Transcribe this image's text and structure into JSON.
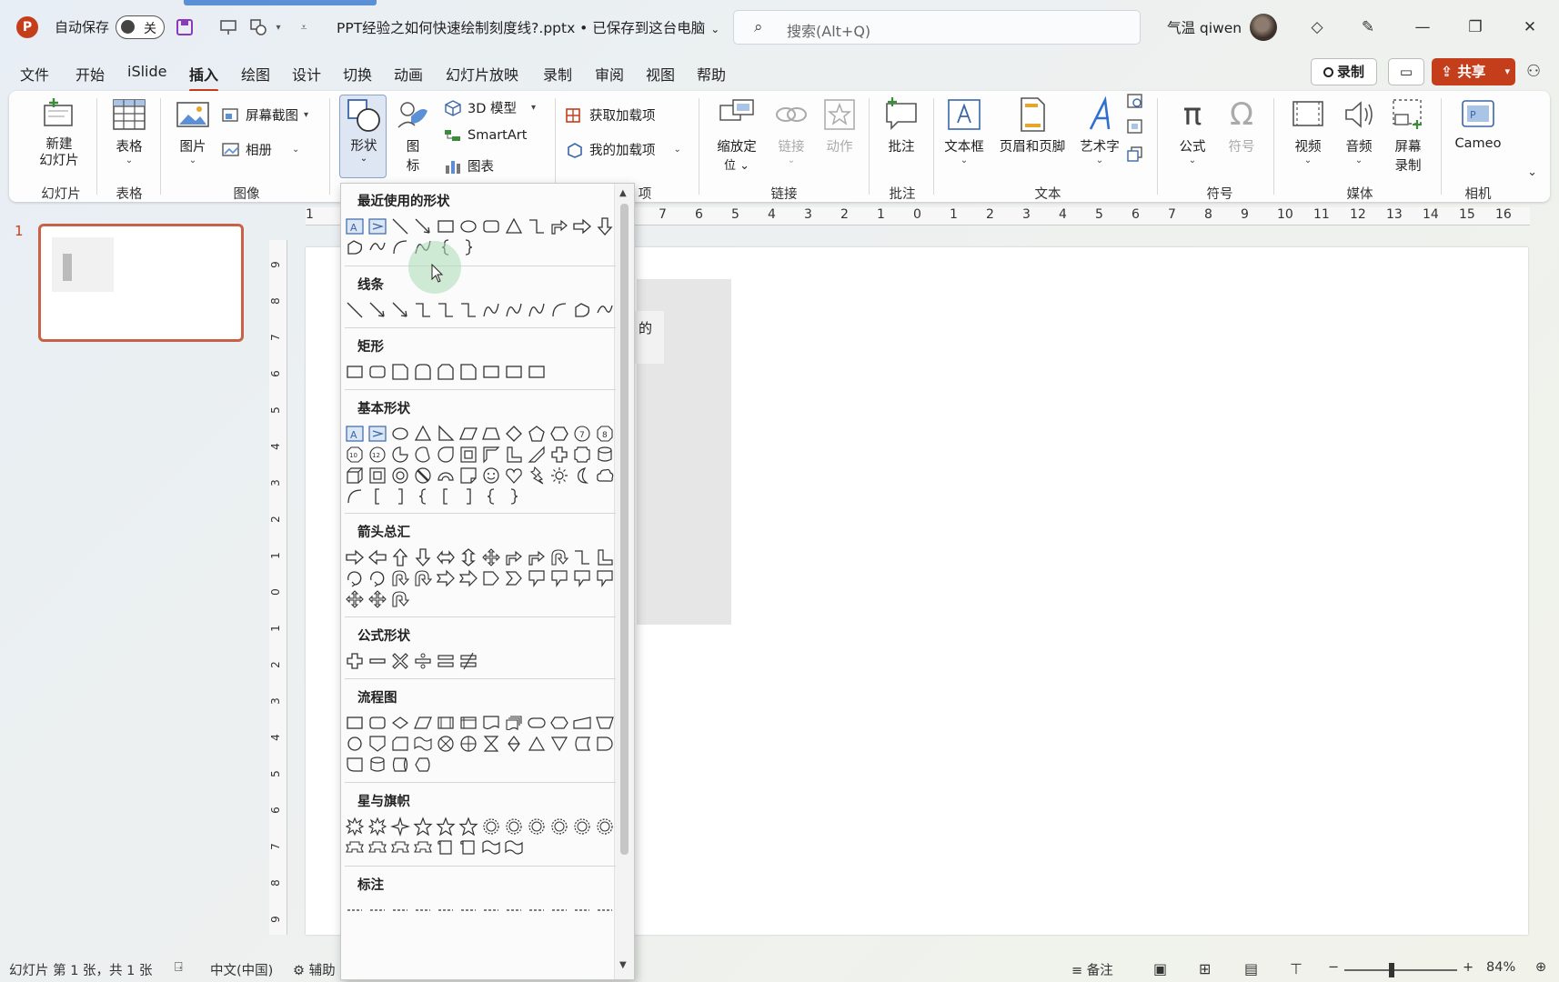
{
  "titlebar": {
    "app_logo": "P",
    "autosave_label": "自动保存",
    "autosave_state": "关",
    "doc_title": "PPT经验之如何快速绘制刻度线?.pptx • 已保存到这台电脑",
    "search_placeholder": "搜索(Alt+Q)",
    "user_name": "气温 qiwen",
    "icons": [
      "save-icon",
      "present-icon",
      "shapes-icon",
      "customize-icon",
      "diamond-icon",
      "pen-icon",
      "minimize-icon",
      "restore-icon",
      "close-icon"
    ]
  },
  "menu": {
    "tabs": [
      "文件",
      "开始",
      "iSlide",
      "插入",
      "绘图",
      "设计",
      "切换",
      "动画",
      "幻灯片放映",
      "录制",
      "审阅",
      "视图",
      "帮助"
    ],
    "active": "插入",
    "record_label": "录制",
    "share_label": "共享"
  },
  "ribbon": {
    "new_slide": "新建\n幻灯片",
    "table": "表格",
    "picture": "图片",
    "screenshot": "屏幕截图",
    "album": "相册",
    "shapes": "形状",
    "icons_line1": "图",
    "icons_line2": "标",
    "model3d": "3D 模型",
    "smartart": "SmartArt",
    "chart": "图表",
    "get_addins": "获取加载项",
    "my_addins": "我的加载项",
    "zoom_line1": "缩放定",
    "zoom_line2": "位",
    "link": "链接",
    "action": "动作",
    "comment": "批注",
    "textbox": "文本框",
    "header_footer": "页眉和页脚",
    "wordart": "艺术字",
    "equation": "公式",
    "symbol": "符号",
    "video": "视频",
    "audio": "音频",
    "screen_rec_line1": "屏幕",
    "screen_rec_line2": "录制",
    "cameo": "Cameo",
    "groups": {
      "slides": "幻灯片",
      "tables": "表格",
      "images": "图像",
      "addins_tail": "项",
      "links": "链接",
      "comments": "批注",
      "text": "文本",
      "symbols": "符号",
      "media": "媒体",
      "camera": "相机"
    }
  },
  "ruler": {
    "h_ticks": [
      "1",
      "7",
      "6",
      "5",
      "4",
      "3",
      "2",
      "1",
      "0",
      "1",
      "2",
      "3",
      "4",
      "5",
      "6",
      "7",
      "8",
      "9",
      "10",
      "11",
      "12",
      "13",
      "14",
      "15",
      "16"
    ],
    "v_ticks": [
      "9",
      "8",
      "7",
      "6",
      "5",
      "4",
      "3",
      "2",
      "1",
      "0",
      "1",
      "2",
      "3",
      "4",
      "5",
      "6",
      "7",
      "8",
      "9"
    ]
  },
  "thumbnail": {
    "slide_number": "1"
  },
  "slide": {
    "text_fragment": "的"
  },
  "shapes_menu": {
    "sections": [
      "最近使用的形状",
      "线条",
      "矩形",
      "基本形状",
      "箭头总汇",
      "公式形状",
      "流程图",
      "星与旗帜",
      "标注"
    ]
  },
  "statusbar": {
    "slide_info": "幻灯片 第 1 张，共 1 张",
    "language": "中文(中国)",
    "accessibility": "辅助",
    "notes": "备注",
    "zoom": "84%",
    "zoom_level_percent": 84
  },
  "colors": {
    "accent": "#c43e1c",
    "selected_button": "#dde6f2"
  }
}
